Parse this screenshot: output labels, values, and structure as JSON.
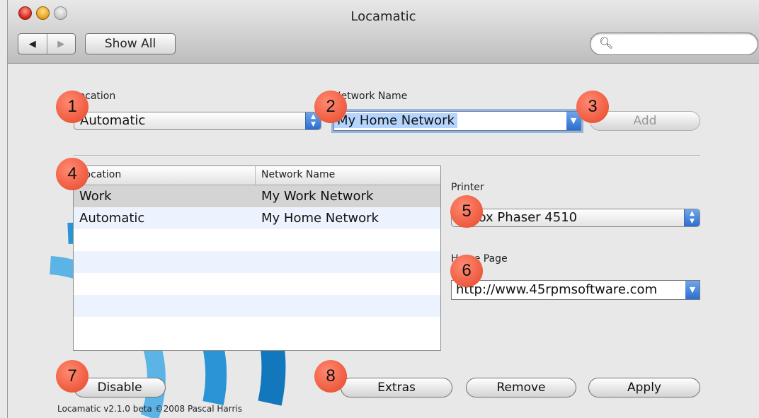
{
  "window": {
    "title": "Locamatic"
  },
  "toolbar": {
    "back": "◀",
    "forward": "▶",
    "show_all": "Show All",
    "search_placeholder": ""
  },
  "form": {
    "location_label": "Location",
    "location_value": "Automatic",
    "network_label": "Network Name",
    "network_value": "My Home Network",
    "add_label": "Add"
  },
  "table": {
    "headers": [
      "Location",
      "Network Name"
    ],
    "rows": [
      {
        "location": "Work",
        "network": "My Work Network"
      },
      {
        "location": "Automatic",
        "network": "My Home Network"
      }
    ]
  },
  "settings": {
    "printer_label": "Printer",
    "printer_value": "Xerox Phaser 4510",
    "homepage_label": "Home Page",
    "homepage_value": "http://www.45rpmsoftware.com"
  },
  "buttons": {
    "disable": "Disable",
    "extras": "Extras",
    "remove": "Remove",
    "apply": "Apply"
  },
  "footer": "Locamatic v2.1.0 beta ©2008 Pascal Harris",
  "badges": [
    "1",
    "2",
    "3",
    "4",
    "5",
    "6",
    "7",
    "8"
  ]
}
